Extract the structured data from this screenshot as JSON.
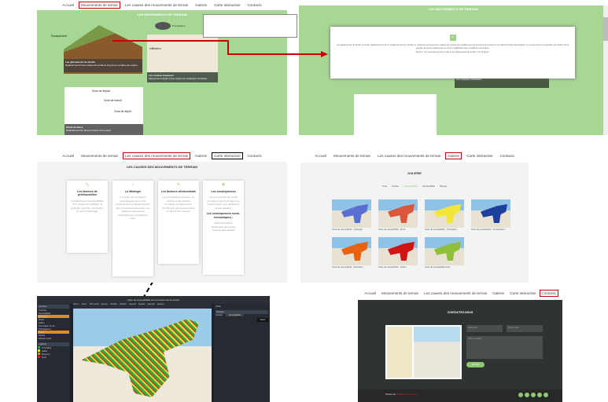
{
  "nav": {
    "items": [
      "Accueil",
      "Mouvements de terrain",
      "Les causes des mouvements de terrain",
      "Galerie",
      "Carte interactive",
      "Contacts"
    ]
  },
  "panel1": {
    "title": "Les mouvements de terrain",
    "cards": [
      {
        "title": "Les glissements de terrain",
        "desc": "Déplacement d'une masse de terrain le long d'une surface de rupture"
      },
      {
        "title": "Les coulées boueuses",
        "desc": "Mouvement rapide d'une masse de matériaux remaniés"
      },
      {
        "title": "Chute de blocs",
        "desc": "Détachement de blocs rocheux d'une paroi"
      }
    ],
    "labels": [
      "Précipitation",
      "Escarpement",
      "Infiltration",
      "Zone de départ",
      "Zone de transit",
      "Zone de dépôt"
    ]
  },
  "panel2": {
    "title": "Les mouvements de terrain",
    "close": "×",
    "text": "Les glissements de terrain sont des déplacements d'une masse de terrain meuble ou rocheuse au long d'une surface de rupture par cisaillement qui correspond souvent à une discontinuité préexistante. Le mouvement est engendré par l'action de la gravité, de forces extérieures ou d'une modification des conditions aux limites.",
    "text2": "Source : les mouvements de terrain et les glissements de terrain, voir la figure.",
    "card": "Les coulées boueuses"
  },
  "panel3": {
    "title": "Les causes des mouvements de terrain",
    "cards": [
      {
        "title": "Les facteurs de prédisposition",
        "text": "Ils déterminent la susceptibilité d'un versant à l'instabilité : la géologie, la pente, l'occupation du sol et l'hydrologie."
      },
      {
        "title": "La lithologie",
        "text": "La nature des formations géologiques joue un rôle essentiel dans le déclenchement des mouvements de terrain. Les argiles et marnes sont particulièrement sensibles à l'eau."
      },
      {
        "title": "Les facteurs déclenchants",
        "text": "Les précipitations intenses, les séismes et les activités humaines (terrassements, surcharges) peuvent provoquer la rupture d'un versant."
      },
      {
        "title": "Les conséquences",
        "text": "Les mouvements de terrain provoquent des dommages aux infrastructures, aux habitations et aux réseaux.",
        "sub": "Les conséquences socio-économiques :",
        "list": [
          "Pertes humaines",
          "Destruction des routes",
          "Coupure des réseaux"
        ]
      }
    ]
  },
  "panel4": {
    "title": "Galerie",
    "filters": [
      "Tous",
      "Cartes",
      "Susceptibilité",
      "Vulnérabilité",
      "Risque"
    ],
    "items": [
      {
        "caption": "Carte de susceptibilité - Lithologie",
        "color": "#5a6fd1"
      },
      {
        "caption": "Carte de susceptibilité - Pente",
        "color": "#d9573a"
      },
      {
        "caption": "Carte de susceptibilité - Occupation",
        "color": "#f2e53c"
      },
      {
        "caption": "Carte de susceptibilité - Précipitations",
        "color": "#1f3f9e"
      },
      {
        "caption": "Carte de susceptibilité - Exposition",
        "color": "#e8620f"
      },
      {
        "caption": "Carte de susceptibilité - Failles",
        "color": "#cf1414"
      },
      {
        "caption": "Carte de susceptibilité finale",
        "color": "#8fbf3a"
      }
    ]
  },
  "panel5": {
    "title": "Carte de susceptibilité aux mouvements de terrain",
    "buttons": [
      "Zoom +",
      "Zoom -",
      "Plein écran",
      "Mesurer",
      "Identifier",
      "Imprimer",
      "Légende",
      "Requête",
      "Sélection",
      "Exporter"
    ],
    "layers_title": "Couches",
    "layers": [
      "Couches",
      "Susceptibilité",
      "Lithologie",
      "Pente",
      "Failles",
      "Occupation du sol",
      "Précipitations",
      "Limite",
      "Routes",
      "Réseau hydro"
    ],
    "legend_title": "Légende",
    "legend": [
      "Très faible",
      "Faible",
      "Moyenne",
      "Forte"
    ],
    "legend_colors": [
      "#2e9e2e",
      "#e6e62e",
      "#e68a1e",
      "#d41e1e"
    ],
    "right_title": "Outils",
    "query": "Requête",
    "search_label": "Couche",
    "search_value": "Susceptibilité",
    "go": "Valider"
  },
  "panel6": {
    "title": "Contactez-nous",
    "name_ph": "Votre nom",
    "email_ph": "Votre email",
    "msg_ph": "Votre message",
    "send": "Envoyer",
    "footer": "Réalisé par",
    "footer_link": "Mouvements de terrain"
  }
}
